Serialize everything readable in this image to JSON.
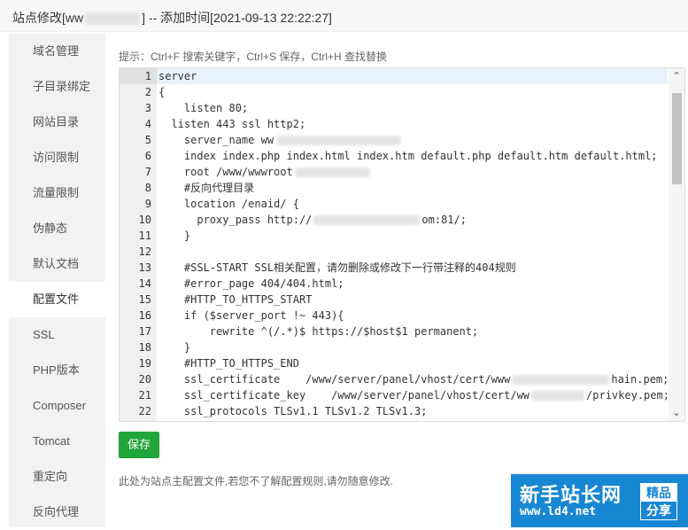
{
  "titlebar": {
    "prefix": "站点修改[ww",
    "suffix": "] -- 添加时间[2021-09-13 22:22:27]"
  },
  "sidebar": {
    "items": [
      {
        "label": "域名管理"
      },
      {
        "label": "子目录绑定"
      },
      {
        "label": "网站目录"
      },
      {
        "label": "访问限制"
      },
      {
        "label": "流量限制"
      },
      {
        "label": "伪静态"
      },
      {
        "label": "默认文档"
      },
      {
        "label": "配置文件",
        "active": true
      },
      {
        "label": "SSL"
      },
      {
        "label": "PHP版本"
      },
      {
        "label": "Composer"
      },
      {
        "label": "Tomcat"
      },
      {
        "label": "重定向"
      },
      {
        "label": "反向代理"
      }
    ]
  },
  "hint": "提示：Ctrl+F 搜索关键字，Ctrl+S 保存，Ctrl+H 查找替换",
  "editor": {
    "line_numbers": [
      "1",
      "2",
      "3",
      "4",
      "5",
      "6",
      "7",
      "8",
      "9",
      "10",
      "11",
      "12",
      "13",
      "14",
      "15",
      "16",
      "17",
      "18",
      "19",
      "20",
      "21",
      "22"
    ],
    "active_line": 1,
    "lines": [
      "server",
      "{",
      "    listen 80;",
      "  listen 443 ssl http2;",
      "    server_name ww",
      "    index index.php index.html index.htm default.php default.htm default.html;",
      "    root /www/wwwroot",
      "    #反向代理目录",
      "    location /enaid/ {",
      "      proxy_pass http://",
      "    }",
      "",
      "    #SSL-START SSL相关配置，请勿删除或修改下一行带注释的404规则",
      "    #error_page 404/404.html;",
      "    #HTTP_TO_HTTPS_START",
      "    if ($server_port !~ 443){",
      "        rewrite ^(/.*)$ https://$host$1 permanent;",
      "    }",
      "    #HTTP_TO_HTTPS_END",
      "    ssl_certificate    /www/server/panel/vhost/cert/www",
      "    ssl_certificate_key    /www/server/panel/vhost/cert/ww",
      "    ssl_protocols TLSv1.1 TLSv1.2 TLSv1.3;"
    ],
    "line10_tail": "om:81/;",
    "line20_tail": "hain.pem;",
    "line21_tail": "/privkey.pem;"
  },
  "save_button": "保存",
  "note": "此处为站点主配置文件,若您不了解配置规则,请勿随意修改.",
  "watermark": {
    "title": "新手站长网",
    "url": "www.ld4.net",
    "badge_top": "精品",
    "badge_bottom": "分享"
  },
  "colors": {
    "accent": "#20a53a",
    "keyword": "#c41a16",
    "comment": "#007f00",
    "watermark_bg": "#1787d4"
  }
}
